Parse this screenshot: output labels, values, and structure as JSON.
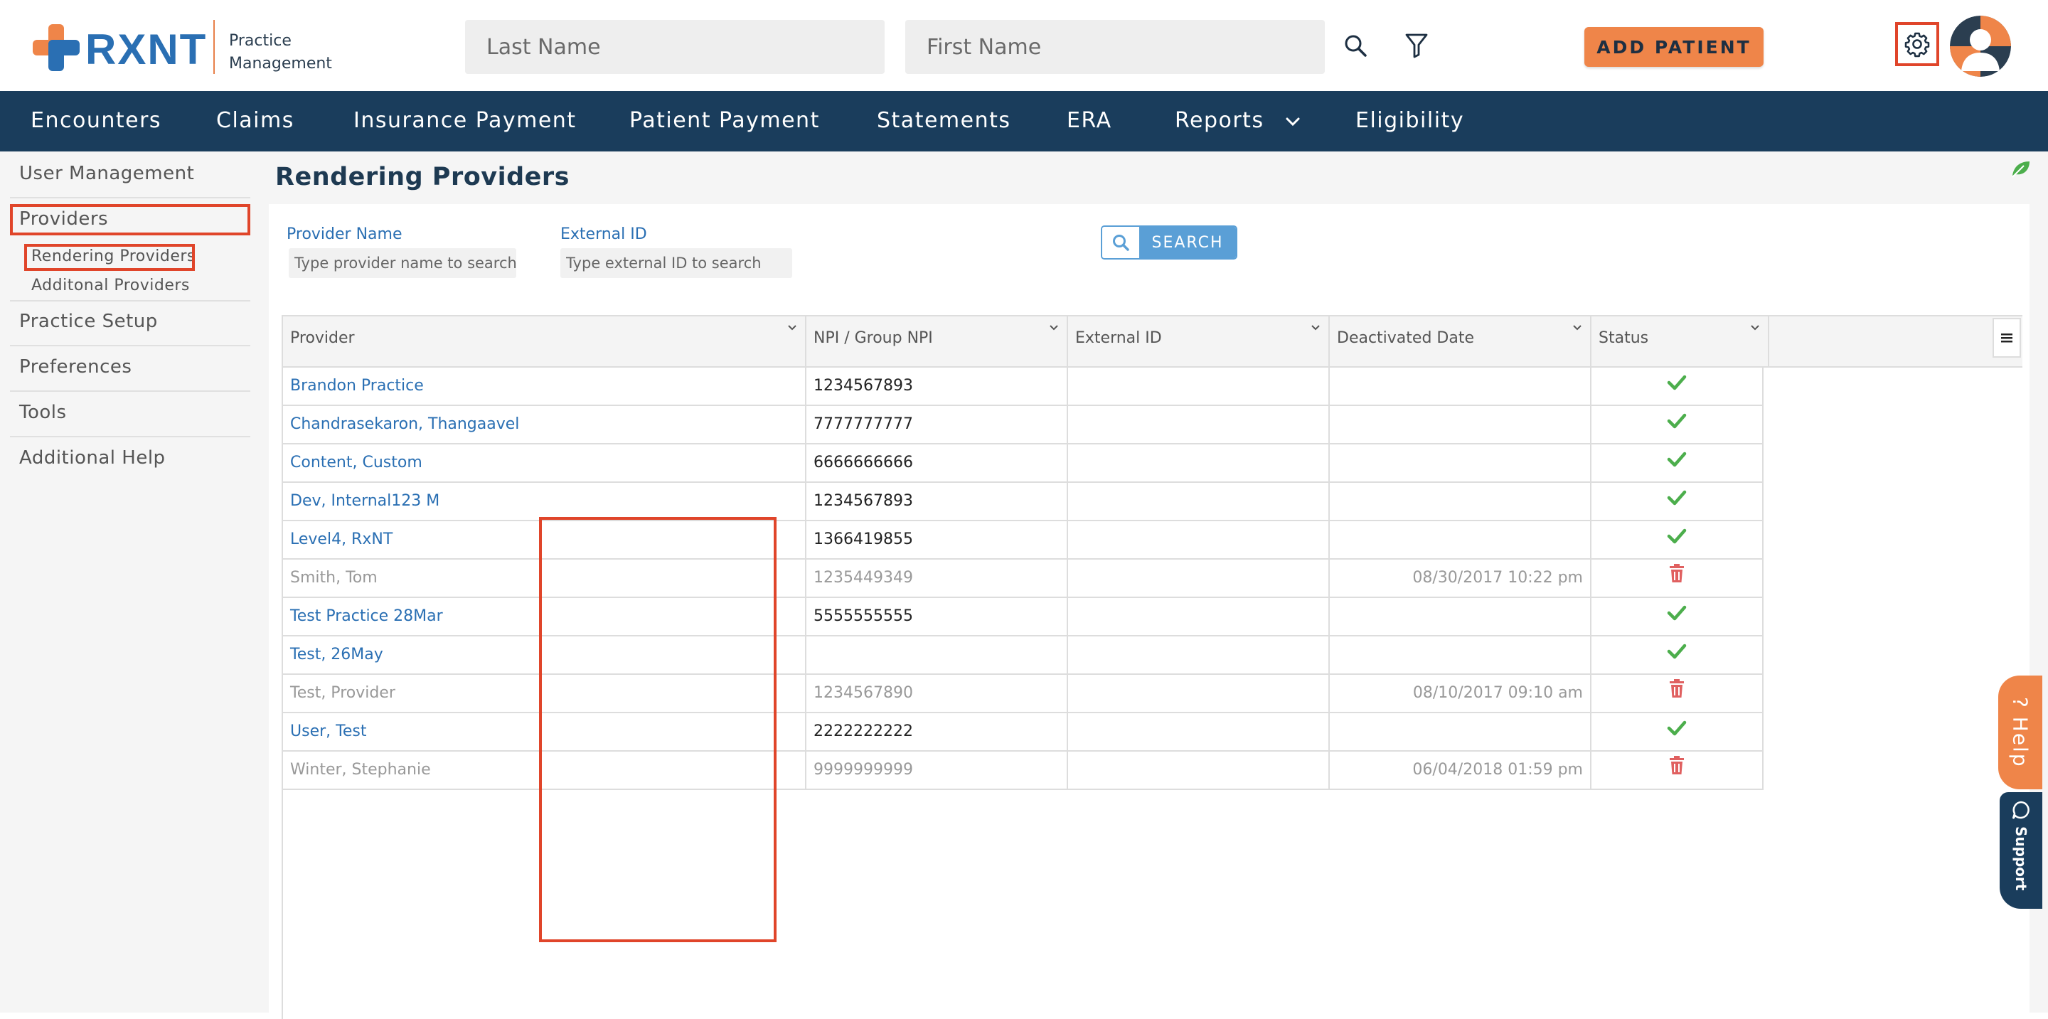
{
  "brand": {
    "logo_text": "RXNT",
    "subtitle_line1": "Practice",
    "subtitle_line2": "Management"
  },
  "header": {
    "last_name_placeholder": "Last Name",
    "first_name_placeholder": "First Name",
    "add_patient_label": "ADD PATIENT"
  },
  "nav": {
    "items": [
      {
        "label": "Encounters"
      },
      {
        "label": "Claims"
      },
      {
        "label": "Insurance Payment"
      },
      {
        "label": "Patient Payment"
      },
      {
        "label": "Statements"
      },
      {
        "label": "ERA"
      },
      {
        "label": "Reports"
      },
      {
        "label": "Eligibility"
      }
    ]
  },
  "sidebar": {
    "items": [
      {
        "label": "User Management"
      },
      {
        "label": "Providers"
      },
      {
        "label": "Practice Setup"
      },
      {
        "label": "Preferences"
      },
      {
        "label": "Tools"
      },
      {
        "label": "Additional Help"
      }
    ],
    "sub_items": [
      {
        "label": "Rendering Providers"
      },
      {
        "label": "Additonal Providers"
      }
    ]
  },
  "main": {
    "title": "Rendering Providers",
    "filters": {
      "provider_name_label": "Provider Name",
      "provider_name_placeholder": "Type provider name to search",
      "external_id_label": "External ID",
      "external_id_placeholder": "Type external ID to search",
      "search_label": "SEARCH"
    },
    "grid": {
      "columns": [
        {
          "label": "Provider"
        },
        {
          "label": "NPI / Group NPI"
        },
        {
          "label": "External ID"
        },
        {
          "label": "Deactivated Date"
        },
        {
          "label": "Status"
        }
      ],
      "rows": [
        {
          "provider": "Brandon Practice",
          "npi": "1234567893",
          "external_id": "",
          "deactivated": "",
          "status": "active"
        },
        {
          "provider": "Chandrasekaron, Thangaavel",
          "npi": "7777777777",
          "external_id": "",
          "deactivated": "",
          "status": "active"
        },
        {
          "provider": "Content, Custom",
          "npi": "6666666666",
          "external_id": "",
          "deactivated": "",
          "status": "active"
        },
        {
          "provider": "Dev, Internal123 M",
          "npi": "1234567893",
          "external_id": "",
          "deactivated": "",
          "status": "active"
        },
        {
          "provider": "Level4, RxNT",
          "npi": "1366419855",
          "external_id": "",
          "deactivated": "",
          "status": "active"
        },
        {
          "provider": "Smith, Tom",
          "npi": "1235449349",
          "external_id": "",
          "deactivated": "08/30/2017 10:22 pm",
          "status": "inactive"
        },
        {
          "provider": "Test Practice 28Mar",
          "npi": "5555555555",
          "external_id": "",
          "deactivated": "",
          "status": "active"
        },
        {
          "provider": "Test, 26May",
          "npi": "",
          "external_id": "",
          "deactivated": "",
          "status": "active"
        },
        {
          "provider": "Test, Provider",
          "npi": "1234567890",
          "external_id": "",
          "deactivated": "08/10/2017 09:10 am",
          "status": "inactive"
        },
        {
          "provider": "User, Test",
          "npi": "2222222222",
          "external_id": "",
          "deactivated": "",
          "status": "active"
        },
        {
          "provider": "Winter, Stephanie",
          "npi": "9999999999",
          "external_id": "",
          "deactivated": "06/04/2018 01:59 pm",
          "status": "inactive"
        }
      ]
    }
  },
  "widgets": {
    "help_label": "? Help",
    "support_label": "Support"
  },
  "colors": {
    "brand_blue": "#2a6fb3",
    "nav_navy": "#1a3d5c",
    "accent_orange": "#ef8549",
    "highlight_red": "#e0452a",
    "check_green": "#4cae4c",
    "trash_red": "#e06060"
  },
  "icons": {
    "active_status": "check-icon",
    "inactive_status": "trash-icon"
  }
}
